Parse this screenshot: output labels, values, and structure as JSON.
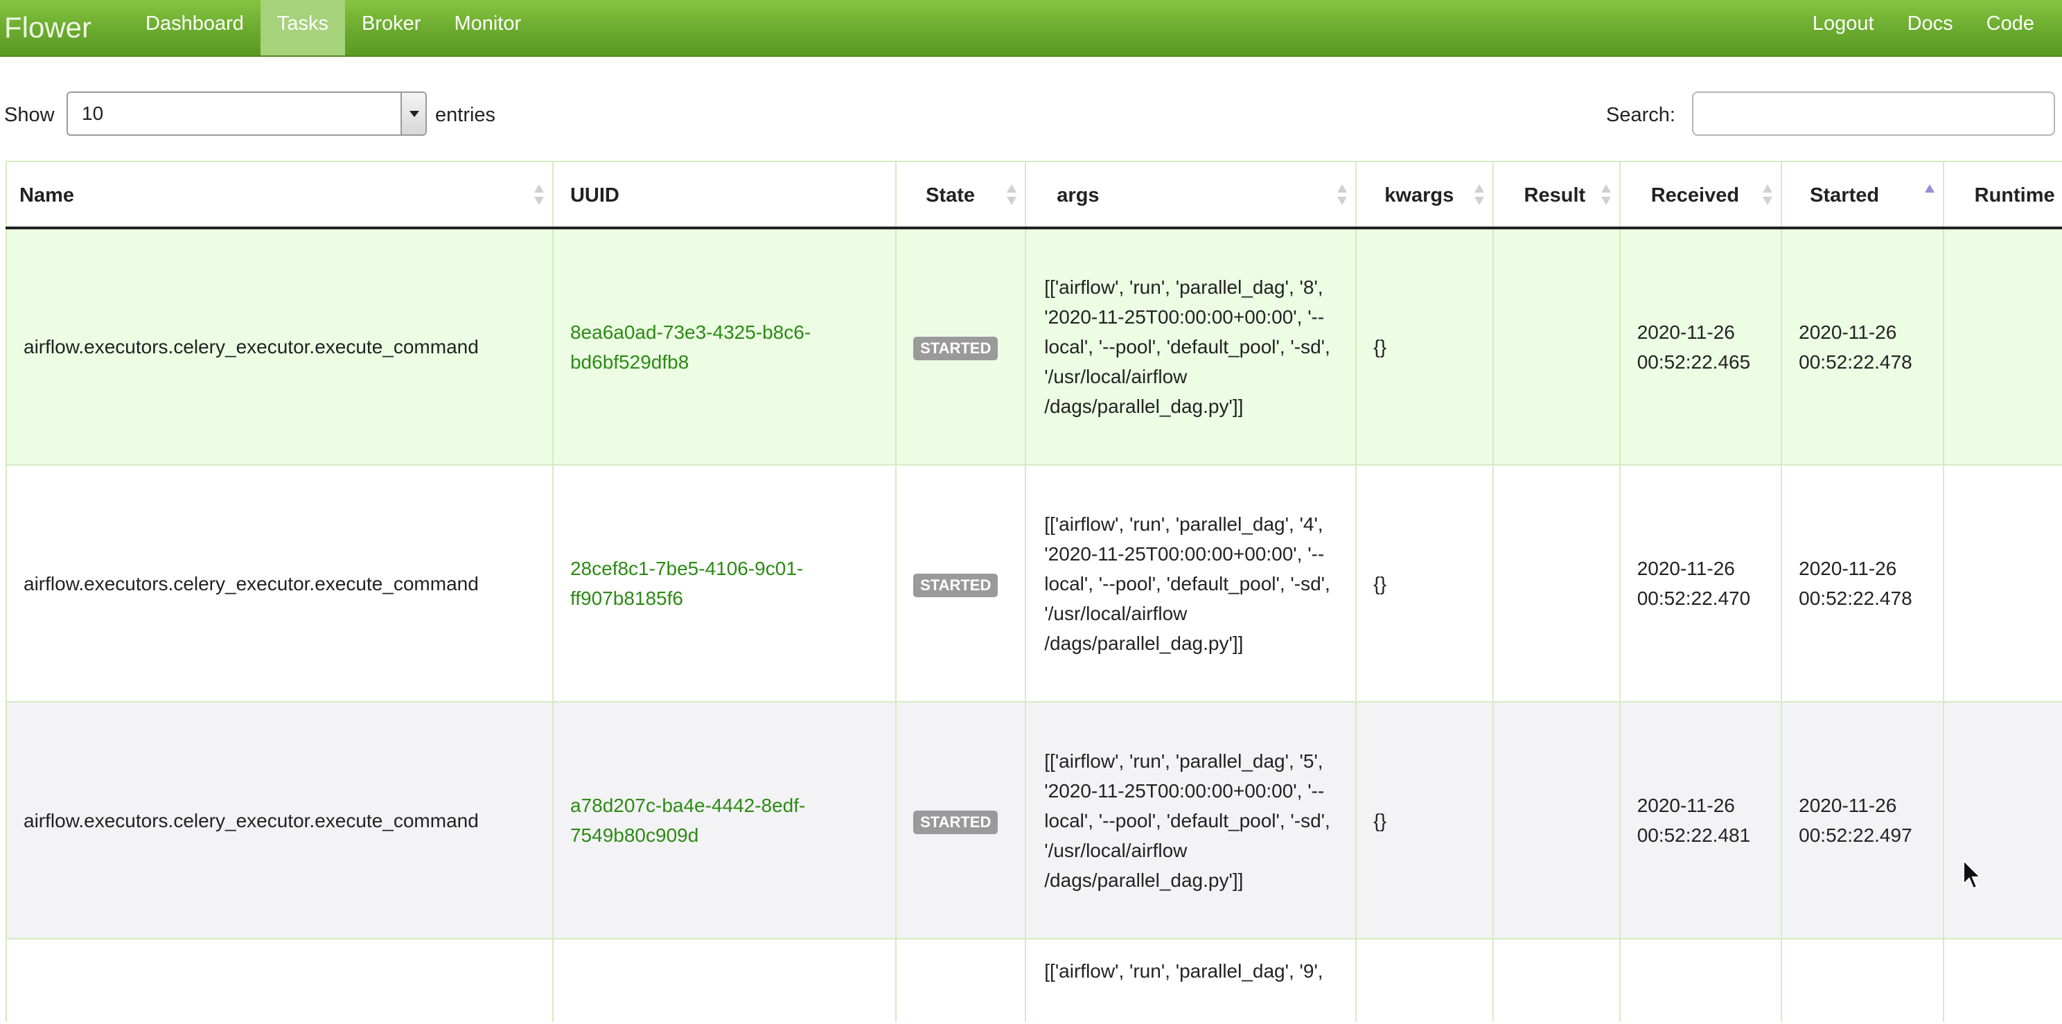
{
  "navbar": {
    "brand": "Flower",
    "left_items": [
      "Dashboard",
      "Tasks",
      "Broker",
      "Monitor"
    ],
    "active": "Tasks",
    "right_items": [
      "Logout",
      "Docs",
      "Code"
    ]
  },
  "controls": {
    "show_label": "Show",
    "length_value": "10",
    "entries_label": "entries",
    "search_label": "Search:",
    "search_value": ""
  },
  "table": {
    "columns": [
      "Name",
      "UUID",
      "State",
      "args",
      "kwargs",
      "Result",
      "Received",
      "Started",
      "Runtime"
    ],
    "sorted_column": "Started",
    "sort_direction": "ascending",
    "rows": [
      {
        "name": "airflow.executors.celery_executor.execute_command",
        "uuid": "8ea6a0ad-73e3-4325-b8c6-bd6bf529dfb8",
        "state": "STARTED",
        "args": "[['airflow', 'run', 'parallel_dag', '8', '2020-11-25T00:00:00+00:00', '--local', '--pool', 'default_pool', '-sd', '/usr/local/airflow /dags/parallel_dag.py']]",
        "kwargs": "{}",
        "result": "",
        "received": "2020-11-26 00:52:22.465",
        "started": "2020-11-26 00:52:22.478",
        "runtime": ""
      },
      {
        "name": "airflow.executors.celery_executor.execute_command",
        "uuid": "28cef8c1-7be5-4106-9c01-ff907b8185f6",
        "state": "STARTED",
        "args": "[['airflow', 'run', 'parallel_dag', '4', '2020-11-25T00:00:00+00:00', '--local', '--pool', 'default_pool', '-sd', '/usr/local/airflow /dags/parallel_dag.py']]",
        "kwargs": "{}",
        "result": "",
        "received": "2020-11-26 00:52:22.470",
        "started": "2020-11-26 00:52:22.478",
        "runtime": ""
      },
      {
        "name": "airflow.executors.celery_executor.execute_command",
        "uuid": "a78d207c-ba4e-4442-8edf-7549b80c909d",
        "state": "STARTED",
        "args": "[['airflow', 'run', 'parallel_dag', '5', '2020-11-25T00:00:00+00:00', '--local', '--pool', 'default_pool', '-sd', '/usr/local/airflow /dags/parallel_dag.py']]",
        "kwargs": "{}",
        "result": "",
        "received": "2020-11-26 00:52:22.481",
        "started": "2020-11-26 00:52:22.497",
        "runtime": ""
      },
      {
        "name": "",
        "uuid": "",
        "state": "",
        "args": "[['airflow', 'run', 'parallel_dag', '9',",
        "kwargs": "",
        "result": "",
        "received": "",
        "started": "",
        "runtime": ""
      }
    ]
  },
  "colors": {
    "navbar": "#6aaa2e",
    "nav_active": "#a5d27a",
    "uuid_link": "#2b8a14",
    "row_highlight": "#ecfde4",
    "badge": "#9a9a9a",
    "sort_active": "#9a8ed6"
  },
  "icons": [
    "sort-icon",
    "sort-ascending-icon",
    "dropdown-arrow-icon",
    "mouse-cursor-icon"
  ]
}
